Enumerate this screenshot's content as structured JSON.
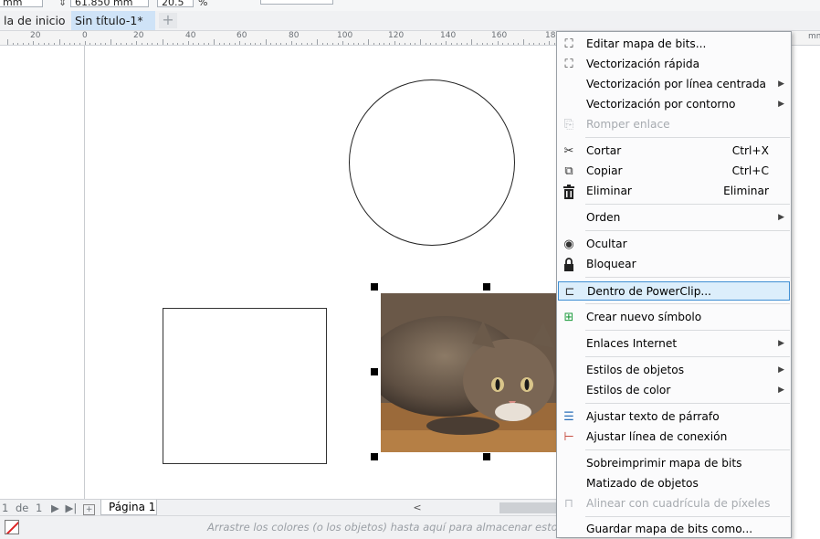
{
  "property_bar": {
    "unit": "mm",
    "size_value": "61.850 mm",
    "scale_value": "20.5",
    "percent_sign": "%"
  },
  "tabs": [
    {
      "label": "la de inicio",
      "active": false
    },
    {
      "label": "Sin título-1*",
      "active": true
    }
  ],
  "tab_add_label": "+",
  "ruler": {
    "labels": [
      "20",
      "0",
      "20",
      "40",
      "60",
      "80",
      "100",
      "120",
      "140",
      "160",
      "18"
    ]
  },
  "page_nav": {
    "first": "|◀",
    "current": "1",
    "of_label": "de",
    "total": "1",
    "next": "▶",
    "last": "▶|",
    "add_page_icon": "add-page-icon",
    "page_tab": "Página 1",
    "scroll_left": "<"
  },
  "status": {
    "hint": "Arrastre los colores (o los objetos) hasta aquí para almacenar estos colores"
  },
  "context_menu": {
    "items": [
      {
        "label": "Editar mapa de bits...",
        "shortcut": "",
        "submenu": false,
        "disabled": false,
        "icon": "edit-bitmap-icon",
        "glyph": "⛶"
      },
      {
        "label": "Vectorización rápida",
        "shortcut": "",
        "submenu": false,
        "disabled": false,
        "icon": "quick-trace-icon",
        "glyph": "⛶"
      },
      {
        "label": "Vectorización por línea centrada",
        "shortcut": "",
        "submenu": true,
        "disabled": false,
        "icon": "",
        "glyph": ""
      },
      {
        "label": "Vectorización por contorno",
        "shortcut": "",
        "submenu": true,
        "disabled": false,
        "icon": "",
        "glyph": ""
      },
      {
        "label": "Romper enlace",
        "shortcut": "",
        "submenu": false,
        "disabled": true,
        "icon": "break-link-icon",
        "glyph": "⎘"
      },
      {
        "label": "Cortar",
        "shortcut": "Ctrl+X",
        "submenu": false,
        "disabled": false,
        "icon": "cut-icon",
        "glyph": "✂"
      },
      {
        "label": "Copiar",
        "shortcut": "Ctrl+C",
        "submenu": false,
        "disabled": false,
        "icon": "copy-icon",
        "glyph": "⧉"
      },
      {
        "label": "Eliminar",
        "shortcut": "Eliminar",
        "submenu": false,
        "disabled": false,
        "icon": "trash-icon",
        "glyph": "🗑"
      },
      {
        "label": "Orden",
        "shortcut": "",
        "submenu": true,
        "disabled": false,
        "icon": "",
        "glyph": ""
      },
      {
        "label": "Ocultar",
        "shortcut": "",
        "submenu": false,
        "disabled": false,
        "icon": "hide-eye-icon",
        "glyph": "◉"
      },
      {
        "label": "Bloquear",
        "shortcut": "",
        "submenu": false,
        "disabled": false,
        "icon": "lock-icon",
        "glyph": "🔒"
      },
      {
        "label": "Dentro de PowerClip...",
        "shortcut": "",
        "submenu": false,
        "disabled": false,
        "icon": "powerclip-icon",
        "glyph": "⊏",
        "highlighted": true
      },
      {
        "label": "Crear nuevo símbolo",
        "shortcut": "",
        "submenu": false,
        "disabled": false,
        "icon": "new-symbol-icon",
        "glyph": "⊞"
      },
      {
        "label": "Enlaces Internet",
        "shortcut": "",
        "submenu": true,
        "disabled": false,
        "icon": "",
        "glyph": ""
      },
      {
        "label": "Estilos de objetos",
        "shortcut": "",
        "submenu": true,
        "disabled": false,
        "icon": "",
        "glyph": ""
      },
      {
        "label": "Estilos de color",
        "shortcut": "",
        "submenu": true,
        "disabled": false,
        "icon": "",
        "glyph": ""
      },
      {
        "label": "Ajustar texto de párrafo",
        "shortcut": "",
        "submenu": false,
        "disabled": false,
        "icon": "wrap-text-icon",
        "glyph": "☰"
      },
      {
        "label": "Ajustar línea de conexión",
        "shortcut": "",
        "submenu": false,
        "disabled": false,
        "icon": "connector-icon",
        "glyph": "⊢"
      },
      {
        "label": "Sobreimprimir mapa de bits",
        "shortcut": "",
        "submenu": false,
        "disabled": false,
        "icon": "",
        "glyph": ""
      },
      {
        "label": "Matizado de objetos",
        "shortcut": "",
        "submenu": false,
        "disabled": false,
        "icon": "",
        "glyph": ""
      },
      {
        "label": "Alinear con cuadrícula de píxeles",
        "shortcut": "",
        "submenu": false,
        "disabled": true,
        "icon": "pixel-grid-icon",
        "glyph": "⊓"
      },
      {
        "label": "Guardar mapa de bits como...",
        "shortcut": "",
        "submenu": false,
        "disabled": false,
        "icon": "",
        "glyph": ""
      }
    ]
  },
  "colors": {
    "selection_highlight": "#dceefb",
    "selection_border": "#3f8fd4",
    "active_tab": "#cfe3f7",
    "no_color_slash": "#dd2222"
  }
}
